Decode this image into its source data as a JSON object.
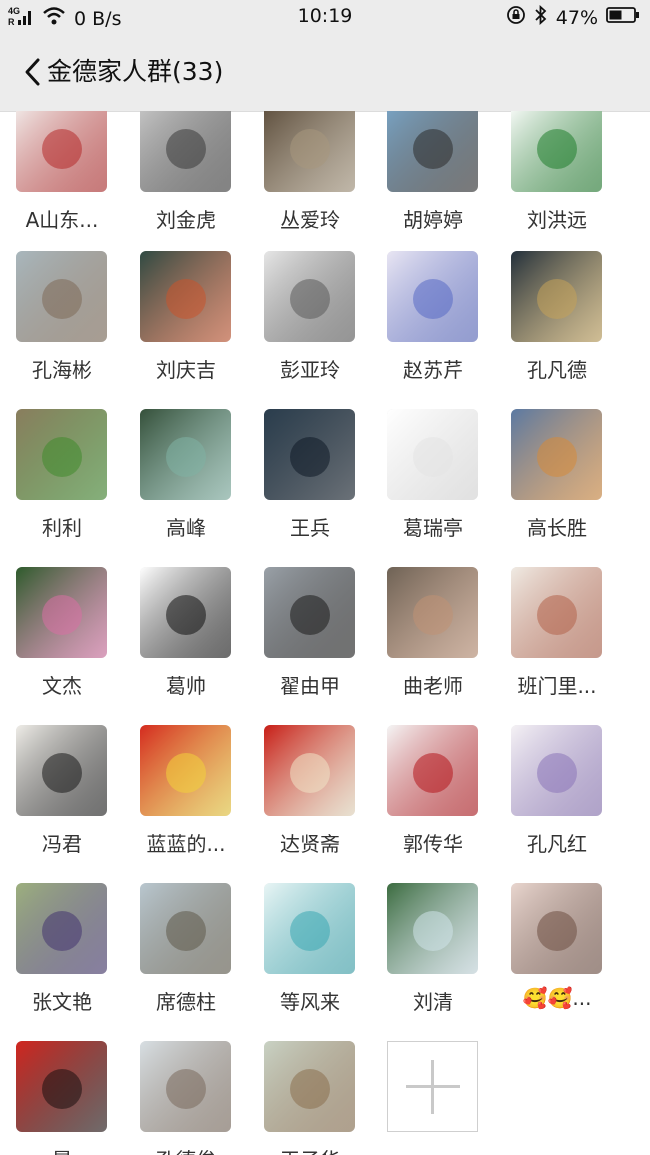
{
  "status_bar": {
    "network_type": "4G",
    "network_speed": "0 B/s",
    "time": "10:19",
    "battery": "47%",
    "icons": [
      "signal-icon",
      "wifi-icon",
      "rotation-lock-icon",
      "bluetooth-icon",
      "battery-icon"
    ]
  },
  "header": {
    "title": "金德家人群(33)",
    "back_icon": "chevron-left-icon"
  },
  "members": [
    {
      "name": "A山东...",
      "colors": [
        "#f3f0ee",
        "#b52a2a"
      ]
    },
    {
      "name": "刘金虎",
      "colors": [
        "#c9c9c9",
        "#3a3a3a"
      ]
    },
    {
      "name": "丛爱玲",
      "colors": [
        "#5a4b3a",
        "#a8987e"
      ]
    },
    {
      "name": "胡婷婷",
      "colors": [
        "#7aa6c8",
        "#2b2b2b"
      ]
    },
    {
      "name": "刘洪远",
      "colors": [
        "#ffffff",
        "#1f7d2c"
      ]
    },
    {
      "name": "孔海彬",
      "colors": [
        "#a9b7bd",
        "#7d6a57"
      ]
    },
    {
      "name": "刘庆吉",
      "colors": [
        "#2f4a43",
        "#c8542c"
      ]
    },
    {
      "name": "彭亚玲",
      "colors": [
        "#e6e6e6",
        "#5b5b5b"
      ]
    },
    {
      "name": "赵苏芹",
      "colors": [
        "#e9e6f3",
        "#5869c4"
      ]
    },
    {
      "name": "孔凡德",
      "colors": [
        "#222f3b",
        "#c4a35a"
      ]
    },
    {
      "name": "利利",
      "colors": [
        "#8a7d5e",
        "#3f8a2c"
      ]
    },
    {
      "name": "高峰",
      "colors": [
        "#35503a",
        "#7fb3a4"
      ]
    },
    {
      "name": "王兵",
      "colors": [
        "#2a3d4d",
        "#0e1a26"
      ]
    },
    {
      "name": "葛瑞亭",
      "colors": [
        "#ffffff",
        "#e4e4e4"
      ]
    },
    {
      "name": "高长胜",
      "colors": [
        "#5a79a3",
        "#d68a3a"
      ]
    },
    {
      "name": "文杰",
      "colors": [
        "#2d5b2b",
        "#d86fa4"
      ]
    },
    {
      "name": "葛帅",
      "colors": [
        "#ffffff",
        "#111111"
      ]
    },
    {
      "name": "翟由甲",
      "colors": [
        "#9aa1a8",
        "#1b1b1b"
      ]
    },
    {
      "name": "曲老师",
      "colors": [
        "#6e6255",
        "#c09275"
      ]
    },
    {
      "name": "班门里...",
      "colors": [
        "#f0ebe4",
        "#b3624a"
      ]
    },
    {
      "name": "冯君",
      "colors": [
        "#efede8",
        "#1a1a1a"
      ]
    },
    {
      "name": "蓝蓝的...",
      "colors": [
        "#d42a1f",
        "#f3d23a"
      ]
    },
    {
      "name": "达贤斋",
      "colors": [
        "#c71d16",
        "#f1e4c7"
      ]
    },
    {
      "name": "郭传华",
      "colors": [
        "#f5f5f5",
        "#b5151b"
      ]
    },
    {
      "name": "孔凡红",
      "colors": [
        "#f5f2f5",
        "#8b74b8"
      ]
    },
    {
      "name": "张文艳",
      "colors": [
        "#9db07e",
        "#43356f"
      ]
    },
    {
      "name": "席德柱",
      "colors": [
        "#b9c7cf",
        "#5e5a4b"
      ]
    },
    {
      "name": "等风来",
      "colors": [
        "#e9f5f5",
        "#3aa8b2"
      ]
    },
    {
      "name": "刘清",
      "colors": [
        "#3b6b3f",
        "#cfe3ea"
      ]
    },
    {
      "name": "🥰🥰...",
      "colors": [
        "#e9d6cf",
        "#6e4e42"
      ]
    },
    {
      "name": "晏",
      "colors": [
        "#d2261f",
        "#1a0f0f"
      ]
    },
    {
      "name": "孔德俊",
      "colors": [
        "#d8dfe3",
        "#7a6a5c"
      ]
    },
    {
      "name": "王子华",
      "colors": [
        "#c9d2c4",
        "#8a6f4e"
      ]
    }
  ],
  "add_member": {
    "icon": "plus-icon"
  }
}
